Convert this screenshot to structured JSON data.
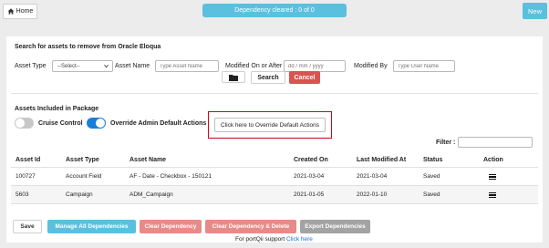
{
  "topbar": {
    "home_label": "Home",
    "home_icon": "home-icon",
    "dependency_banner": "Dependency cleared : 0 of 0",
    "new_label": "New"
  },
  "search": {
    "title": "Search for assets to remove from Oracle Eloqua",
    "asset_type_label": "Asset Type",
    "asset_type_value": "--Select--",
    "asset_name_label": "Asset Name",
    "asset_name_placeholder": "Type Asset Name",
    "modified_on_label": "Modified On or After",
    "modified_on_placeholder": "dd / mm / yyyy",
    "modified_by_label": "Modified By",
    "modified_by_placeholder": "Type User Name",
    "folder_icon": "folder-icon",
    "search_label": "Search",
    "cancel_label": "Cancel"
  },
  "package": {
    "title": "Assets Included in Package",
    "cruise_control_label": "Cruise Control",
    "cruise_control_on": false,
    "override_admin_label": "Override Admin Default Actions",
    "override_admin_on": true,
    "override_button_label": "Click here to Override Default Actions",
    "filter_label": "Filter :"
  },
  "table": {
    "headers": [
      "Asset Id",
      "Asset Type",
      "Asset Name",
      "Created On",
      "Last Modified At",
      "Status",
      "Action"
    ],
    "rows": [
      {
        "id": "100727",
        "type": "Account Field",
        "name": "AF - Date - Checkbox - 150121",
        "created": "2021-03-04",
        "modified": "2021-03-04",
        "status": "Saved",
        "action_icon": "menu-icon"
      },
      {
        "id": "5603",
        "type": "Campaign",
        "name": "ADM_Campaign",
        "created": "2021-01-05",
        "modified": "2022-01-10",
        "status": "Saved",
        "action_icon": "menu-icon"
      }
    ]
  },
  "footer": {
    "save_label": "Save",
    "manage_label": "Manage All Dependencies",
    "clear_dependency_label": "Clear Dependency",
    "clear_delete_label": "Clear Dependency & Delete",
    "export_label": "Export Dependencies",
    "support_text": "For portQii support",
    "support_link": "Click here"
  },
  "colors": {
    "accent": "#5bc0de",
    "danger": "#d9534f",
    "danger_light": "#e88a87",
    "toggle_on": "#1a7fd6",
    "highlight": "#d0021b"
  }
}
